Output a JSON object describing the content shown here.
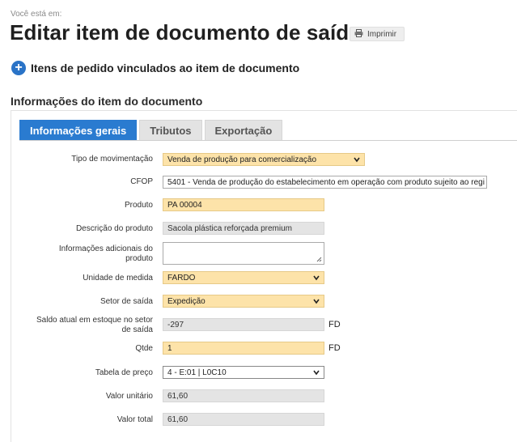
{
  "breadcrumb": "Você está em:",
  "title": "Editar item de documento de saída",
  "print_label": "Imprimir",
  "linked_items_label": "Itens de pedido vinculados ao item de documento",
  "section_title": "Informações do item do documento",
  "tabs": [
    {
      "label": "Informações gerais",
      "active": true
    },
    {
      "label": "Tributos",
      "active": false
    },
    {
      "label": "Exportação",
      "active": false
    }
  ],
  "form": {
    "tipo_movimentacao": {
      "label": "Tipo de movimentação",
      "value": "Venda de produção para comercialização"
    },
    "cfop": {
      "label": "CFOP",
      "value": "5401 - Venda de produção do estabelecimento em operação com produto sujeito ao regi"
    },
    "produto": {
      "label": "Produto",
      "value": "PA 00004"
    },
    "descricao": {
      "label": "Descrição do produto",
      "value": "Sacola plástica reforçada premium"
    },
    "info_adicionais": {
      "label_line1": "Informações adicionais do",
      "label_line2": "produto",
      "value": ""
    },
    "unidade": {
      "label": "Unidade de medida",
      "value": "FARDO"
    },
    "setor": {
      "label": "Setor de saída",
      "value": "Expedição"
    },
    "saldo": {
      "label_line1": "Saldo atual em estoque no setor",
      "label_line2": "de saída",
      "value": "-297",
      "unit": "FD"
    },
    "qtde": {
      "label": "Qtde",
      "value": "1",
      "unit": "FD"
    },
    "tabela_preco": {
      "label": "Tabela de preço",
      "value": "4 - E:01 | L0C10"
    },
    "valor_unitario": {
      "label": "Valor unitário",
      "value": "61,60"
    },
    "valor_total": {
      "label": "Valor total",
      "value": "61,60"
    }
  },
  "colors": {
    "accent": "#2a7bd0",
    "required_field": "#fde3a9",
    "readonly_field": "#e4e4e4"
  },
  "icons": {
    "print": "printer-icon",
    "add": "plus-circle-icon",
    "dropdown": "chevron-down-icon"
  }
}
